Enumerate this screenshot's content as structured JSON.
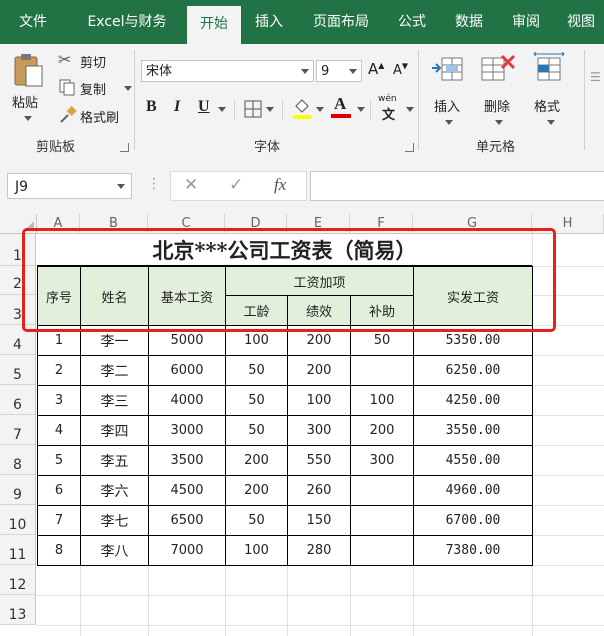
{
  "tabs": [
    "文件",
    "Excel与财务",
    "开始",
    "插入",
    "页面布局",
    "公式",
    "数据",
    "审阅",
    "视图"
  ],
  "active_tab": "开始",
  "ribbon": {
    "paste": "粘贴",
    "cut": "剪切",
    "copy": "复制",
    "format_painter": "格式刷",
    "clipboard_group": "剪贴板",
    "font_name": "宋体",
    "font_size": "9",
    "bold": "B",
    "italic": "I",
    "underline": "U",
    "font_color_letter": "A",
    "phonetic": "wén",
    "font_group": "字体",
    "insert": "插入",
    "delete": "删除",
    "format": "格式",
    "cells_group": "单元格",
    "accent_red": "#e00000",
    "accent_yellow": "#ffff00"
  },
  "formula_bar": {
    "name_box": "J9",
    "fx": "fx",
    "formula": ""
  },
  "sheet": {
    "columns": [
      "A",
      "B",
      "C",
      "D",
      "E",
      "F",
      "G",
      "H"
    ],
    "rows": [
      "1",
      "2",
      "3",
      "4",
      "5",
      "6",
      "7",
      "8",
      "9",
      "10",
      "11",
      "12",
      "13"
    ],
    "title": "北京***公司工资表（简易）",
    "headers": {
      "seq": "序号",
      "name": "姓名",
      "base": "基本工资",
      "extra": "工资加项",
      "seniority": "工龄",
      "performance": "绩效",
      "subsidy": "补助",
      "actual": "实发工资"
    },
    "data": [
      [
        "1",
        "李一",
        "5000",
        "100",
        "200",
        "50",
        "5350.00"
      ],
      [
        "2",
        "李二",
        "6000",
        "50",
        "200",
        "",
        "6250.00"
      ],
      [
        "3",
        "李三",
        "4000",
        "50",
        "100",
        "100",
        "4250.00"
      ],
      [
        "4",
        "李四",
        "3000",
        "50",
        "300",
        "200",
        "3550.00"
      ],
      [
        "5",
        "李五",
        "3500",
        "200",
        "550",
        "300",
        "4550.00"
      ],
      [
        "6",
        "李六",
        "4500",
        "200",
        "260",
        "",
        "4960.00"
      ],
      [
        "7",
        "李七",
        "6500",
        "50",
        "150",
        "",
        "6700.00"
      ],
      [
        "8",
        "李八",
        "7000",
        "100",
        "280",
        "",
        "7380.00"
      ]
    ],
    "header_fill": "#e2efda",
    "highlight_color": "#e8201a"
  }
}
